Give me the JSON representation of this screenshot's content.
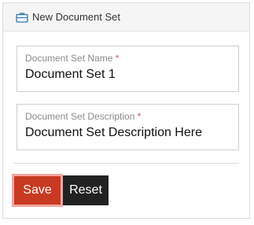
{
  "panel": {
    "title": "New Document Set",
    "icon": "briefcase-icon"
  },
  "fields": {
    "name": {
      "label": "Document Set Name",
      "required_marker": "*",
      "value": "Document Set 1"
    },
    "description": {
      "label": "Document Set Description",
      "required_marker": "*",
      "value": "Document Set Description Here"
    }
  },
  "buttons": {
    "save": "Save",
    "reset": "Reset"
  },
  "colors": {
    "save_bg": "#c83a22",
    "reset_bg": "#222222",
    "required": "#d9534f",
    "icon": "#2a7ab8"
  }
}
